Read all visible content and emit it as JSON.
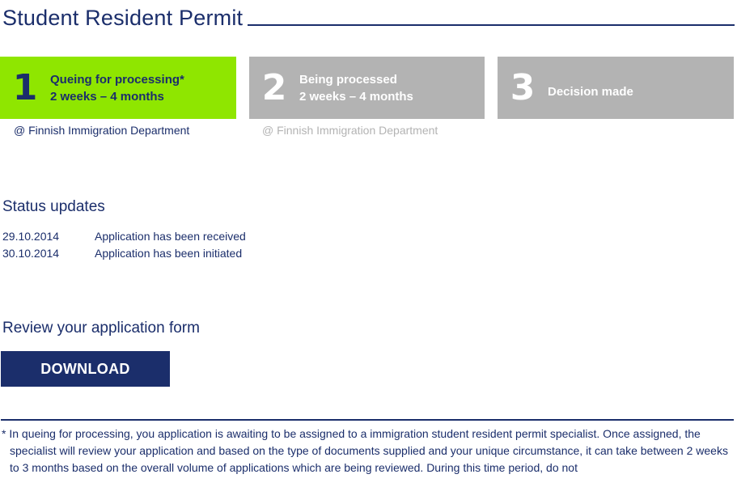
{
  "page": {
    "title": "Student Resident Permit"
  },
  "steps": [
    {
      "number": "1",
      "label": "Queing for processing*",
      "duration": "2 weeks – 4 months",
      "state": "active",
      "color": "#8fe600"
    },
    {
      "number": "2",
      "label": "Being processed",
      "duration": "2 weeks – 4 months",
      "state": "pending",
      "color": "#b3b3b3"
    },
    {
      "number": "3",
      "label": "Decision  made",
      "duration": "",
      "state": "pending",
      "color": "#b3b3b3"
    }
  ],
  "departments": [
    "@ Finnish Immigration Department",
    "@ Finnish Immigration Department"
  ],
  "status": {
    "heading": "Status updates",
    "updates": [
      {
        "date": "29.10.2014",
        "text": "Application has been received"
      },
      {
        "date": "30.10.2014",
        "text": "Application has been initiated"
      }
    ]
  },
  "review": {
    "heading": "Review your application form",
    "download_label": "DOWNLOAD"
  },
  "footnote": "* In queing for processing, you application is awaiting to be assigned to a immigration student resident permit specialist. Once assigned, the specialist  will review your application and based on the type of documents supplied and your unique circumstance, it can take between 2 weeks to 3 months based on the overall volume of applications which are being reviewed. During this time period, do not",
  "colors": {
    "brand_navy": "#1b2e6b",
    "active_step": "#8fe600",
    "inactive_step": "#b3b3b3"
  }
}
